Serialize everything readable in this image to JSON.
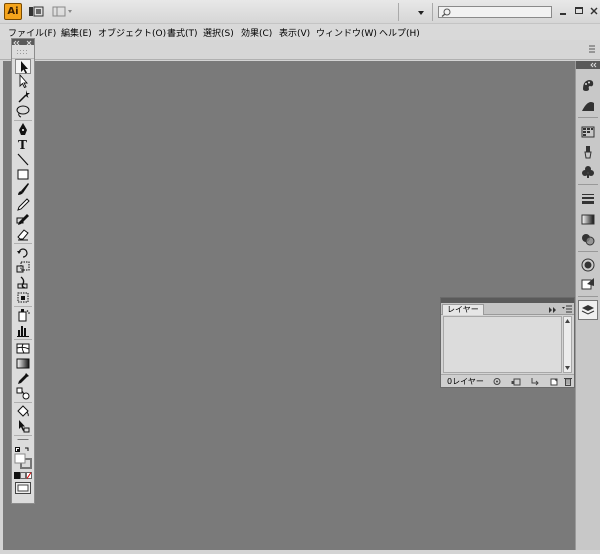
{
  "app": {
    "logo_text": "Ai",
    "menu": [
      "ファイル(F)",
      "編集(E)",
      "オブジェクト(O)",
      "書式(T)",
      "選択(S)",
      "効果(C)",
      "表示(V)",
      "ウィンドウ(W)",
      "ヘルプ(H)"
    ],
    "search": {
      "value": "",
      "placeholder": ""
    },
    "accent_color": "#f4a41c",
    "canvas_color": "#7a7a7a"
  },
  "toolbox": {
    "tools": [
      "selection-tool",
      "direct-selection-tool",
      "magic-wand-tool",
      "lasso-tool",
      "pen-tool",
      "type-tool",
      "line-segment-tool",
      "rectangle-tool",
      "paintbrush-tool",
      "pencil-tool",
      "blob-brush-tool",
      "eraser-tool",
      "rotate-tool",
      "scale-tool",
      "warp-tool",
      "free-transform-tool",
      "symbol-sprayer-tool",
      "column-graph-tool",
      "mesh-tool",
      "gradient-tool",
      "eyedropper-tool",
      "blend-tool",
      "live-paint-bucket-tool",
      "live-paint-selection-tool",
      "artboard-tool",
      "slice-tool",
      "hand-tool",
      "zoom-tool"
    ]
  },
  "dock": {
    "icons": [
      "color-icon",
      "color-guide-icon",
      "swatches-icon",
      "brushes-icon",
      "symbols-icon",
      "stroke-icon",
      "gradient-icon",
      "transparency-icon",
      "appearance-icon",
      "graphic-styles-icon",
      "layers-icon"
    ]
  },
  "layers_panel": {
    "tab_label": "レイヤー",
    "count_label": "0レイヤー",
    "footer_buttons": [
      "locate-object-icon",
      "make-clipping-mask-icon",
      "new-sublayer-icon",
      "new-layer-icon",
      "delete-layer-icon"
    ]
  }
}
